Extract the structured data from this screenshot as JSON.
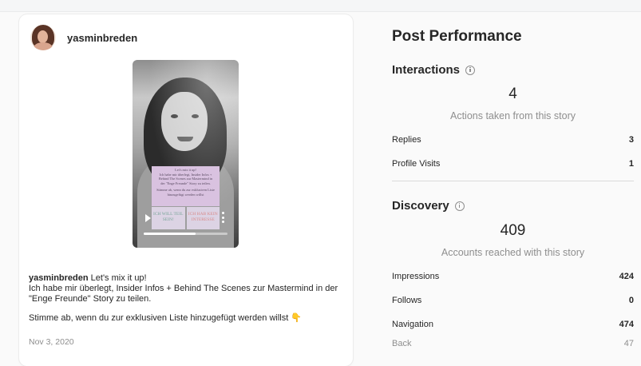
{
  "post": {
    "username": "yasminbreden",
    "story": {
      "note_lines": [
        "Let's mix it up!",
        "Ich habe mir überlegt, Insider Infos +",
        "Behind The Scenes zur Mastermind in",
        "der \"Enge Freunde\" Story zu teilen."
      ],
      "note_lines2": [
        "Stimme ab, wenn du zur exklusiven Liste",
        "hinzugefügt werden willst"
      ],
      "poll_a": "ICH WILL TEIL SEIN!",
      "poll_b": "ICH HAB KEIN INTERESSE",
      "progress": 0.62
    },
    "caption": {
      "username": "yasminbreden",
      "line1": " Let's mix it up!",
      "line2": "Ich habe mir überlegt, Insider Infos + Behind The Scenes zur Mastermind in der \"Enge Freunde\" Story zu teilen.",
      "line3": "Stimme ab, wenn du zur exklusiven Liste hinzugefügt werden willst 👇"
    },
    "date": "Nov 3, 2020"
  },
  "performance": {
    "title": "Post Performance",
    "interactions": {
      "title": "Interactions",
      "total": "4",
      "total_label": "Actions taken from this story",
      "rows": [
        {
          "label": "Replies",
          "value": "3"
        },
        {
          "label": "Profile Visits",
          "value": "1"
        }
      ]
    },
    "discovery": {
      "title": "Discovery",
      "total": "409",
      "total_label": "Accounts reached with this story",
      "rows": [
        {
          "label": "Impressions",
          "value": "424"
        },
        {
          "label": "Follows",
          "value": "0"
        },
        {
          "label": "Navigation",
          "value": "474"
        },
        {
          "label": "Back",
          "value": "47"
        }
      ]
    }
  },
  "icons": {
    "info": "info-circle-icon",
    "play": "play-icon",
    "more": "more-vertical-icon"
  }
}
